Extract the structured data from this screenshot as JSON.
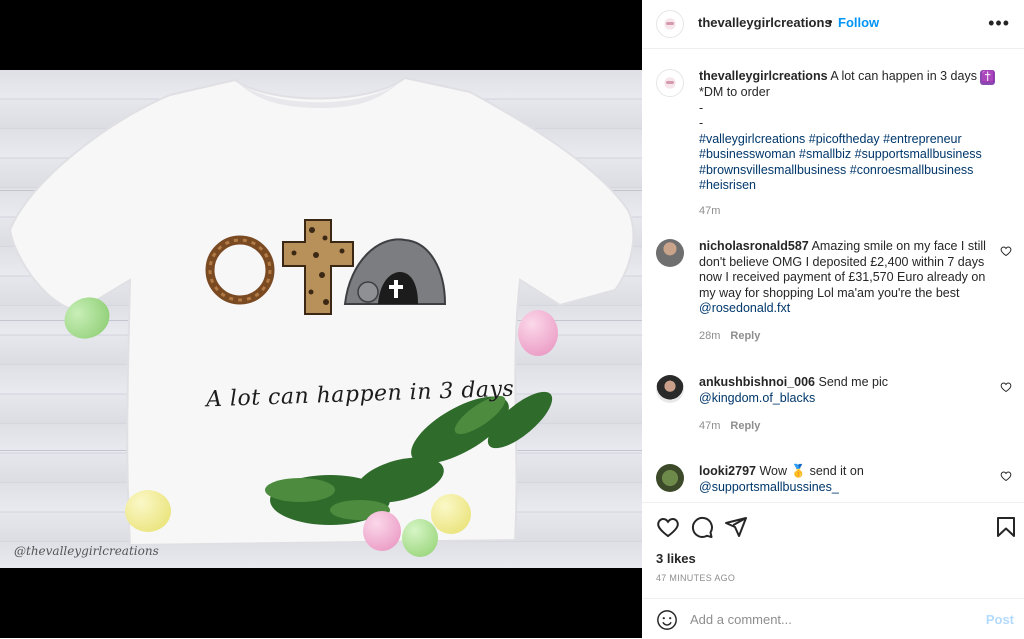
{
  "post_image": {
    "shirt_text": "A lot can happen in 3 days",
    "watermark": "@thevalleygirlcreations"
  },
  "header": {
    "username": "thevalleygirlcreations",
    "separator": "•",
    "follow_label": "Follow",
    "more_icon": "more-horizontal-icon"
  },
  "caption": {
    "username": "thevalleygirlcreations",
    "text": "A lot can happen in 3 days",
    "emoji": "✝️",
    "line2": "*DM to order",
    "line3": "-",
    "line4": "-",
    "hashtags_1": "#valleygirlcreations #picoftheday #entrepreneur",
    "hashtags_2": "#businesswoman #smallbiz #supportsmallbusiness",
    "hashtags_3": "#brownsvillesmallbusiness #conroesmallbusiness",
    "hashtags_4": "#heisrisen",
    "time": "47m"
  },
  "comments": [
    {
      "username": "nicholasronald587",
      "text": "Amazing smile on my face I still don't believe OMG I deposited £2,400 within 7 days now I received payment of £31,570 Euro already on my way for shopping Lol ma'am you're the best",
      "mention": "@rosedonald.fxt",
      "time": "28m",
      "reply": "Reply"
    },
    {
      "username": "ankushbishnoi_006",
      "text": "Send me pic",
      "mention": "@kingdom.of_blacks",
      "time": "47m",
      "reply": "Reply"
    },
    {
      "username": "looki2797",
      "text_before": "Wow",
      "emoji": "🥇",
      "text_after": "send it on",
      "mention": "@supportsmallbussines_"
    }
  ],
  "actions": {
    "likes": "3 likes",
    "time": "47 MINUTES AGO"
  },
  "add_comment": {
    "placeholder": "Add a comment...",
    "post_label": "Post"
  }
}
